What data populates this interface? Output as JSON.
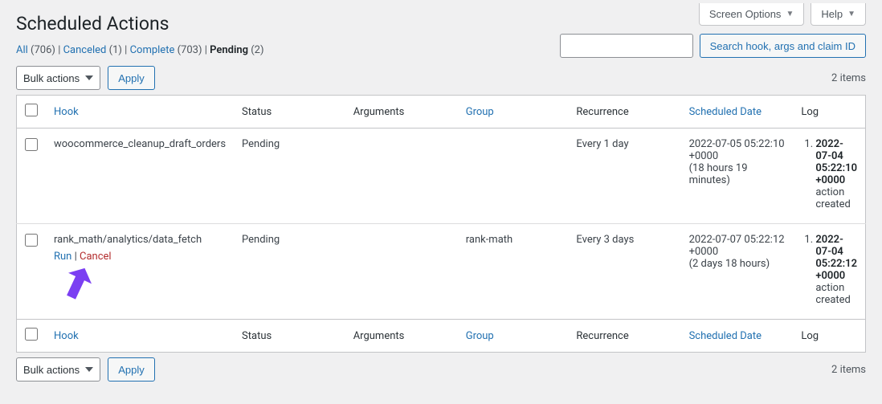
{
  "screen_options": {
    "screen_options_label": "Screen Options",
    "help_label": "Help"
  },
  "page": {
    "title": "Scheduled Actions"
  },
  "filters": {
    "all_label": "All",
    "all_count": "(706)",
    "canceled_label": "Canceled",
    "canceled_count": "(1)",
    "complete_label": "Complete",
    "complete_count": "(703)",
    "pending_label": "Pending",
    "pending_count": "(2)"
  },
  "search": {
    "placeholder": "",
    "button_label": "Search hook, args and claim ID"
  },
  "bulk": {
    "select_label": "Bulk actions",
    "apply_label": "Apply"
  },
  "pagination": {
    "items_text": "2 items"
  },
  "columns": {
    "hook": "Hook",
    "status": "Status",
    "arguments": "Arguments",
    "group": "Group",
    "recurrence": "Recurrence",
    "scheduled": "Scheduled Date",
    "log": "Log"
  },
  "rows": [
    {
      "hook": "woocommerce_cleanup_draft_orders",
      "status": "Pending",
      "arguments": "",
      "group": "",
      "recurrence": "Every 1 day",
      "scheduled_ts": "2022-07-05 05:22:10 +0000",
      "scheduled_rel": "(18 hours 19 minutes)",
      "log_when": "2022-07-04 05:22:10 +0000",
      "log_msg": "action created",
      "show_actions": false,
      "run_label": "Run",
      "cancel_label": "Cancel"
    },
    {
      "hook": "rank_math/analytics/data_fetch",
      "status": "Pending",
      "arguments": "",
      "group": "rank-math",
      "recurrence": "Every 3 days",
      "scheduled_ts": "2022-07-07 05:22:12 +0000",
      "scheduled_rel": "(2 days 18 hours)",
      "log_when": "2022-07-04 05:22:12 +0000",
      "log_msg": "action created",
      "show_actions": true,
      "run_label": "Run",
      "cancel_label": "Cancel"
    }
  ]
}
